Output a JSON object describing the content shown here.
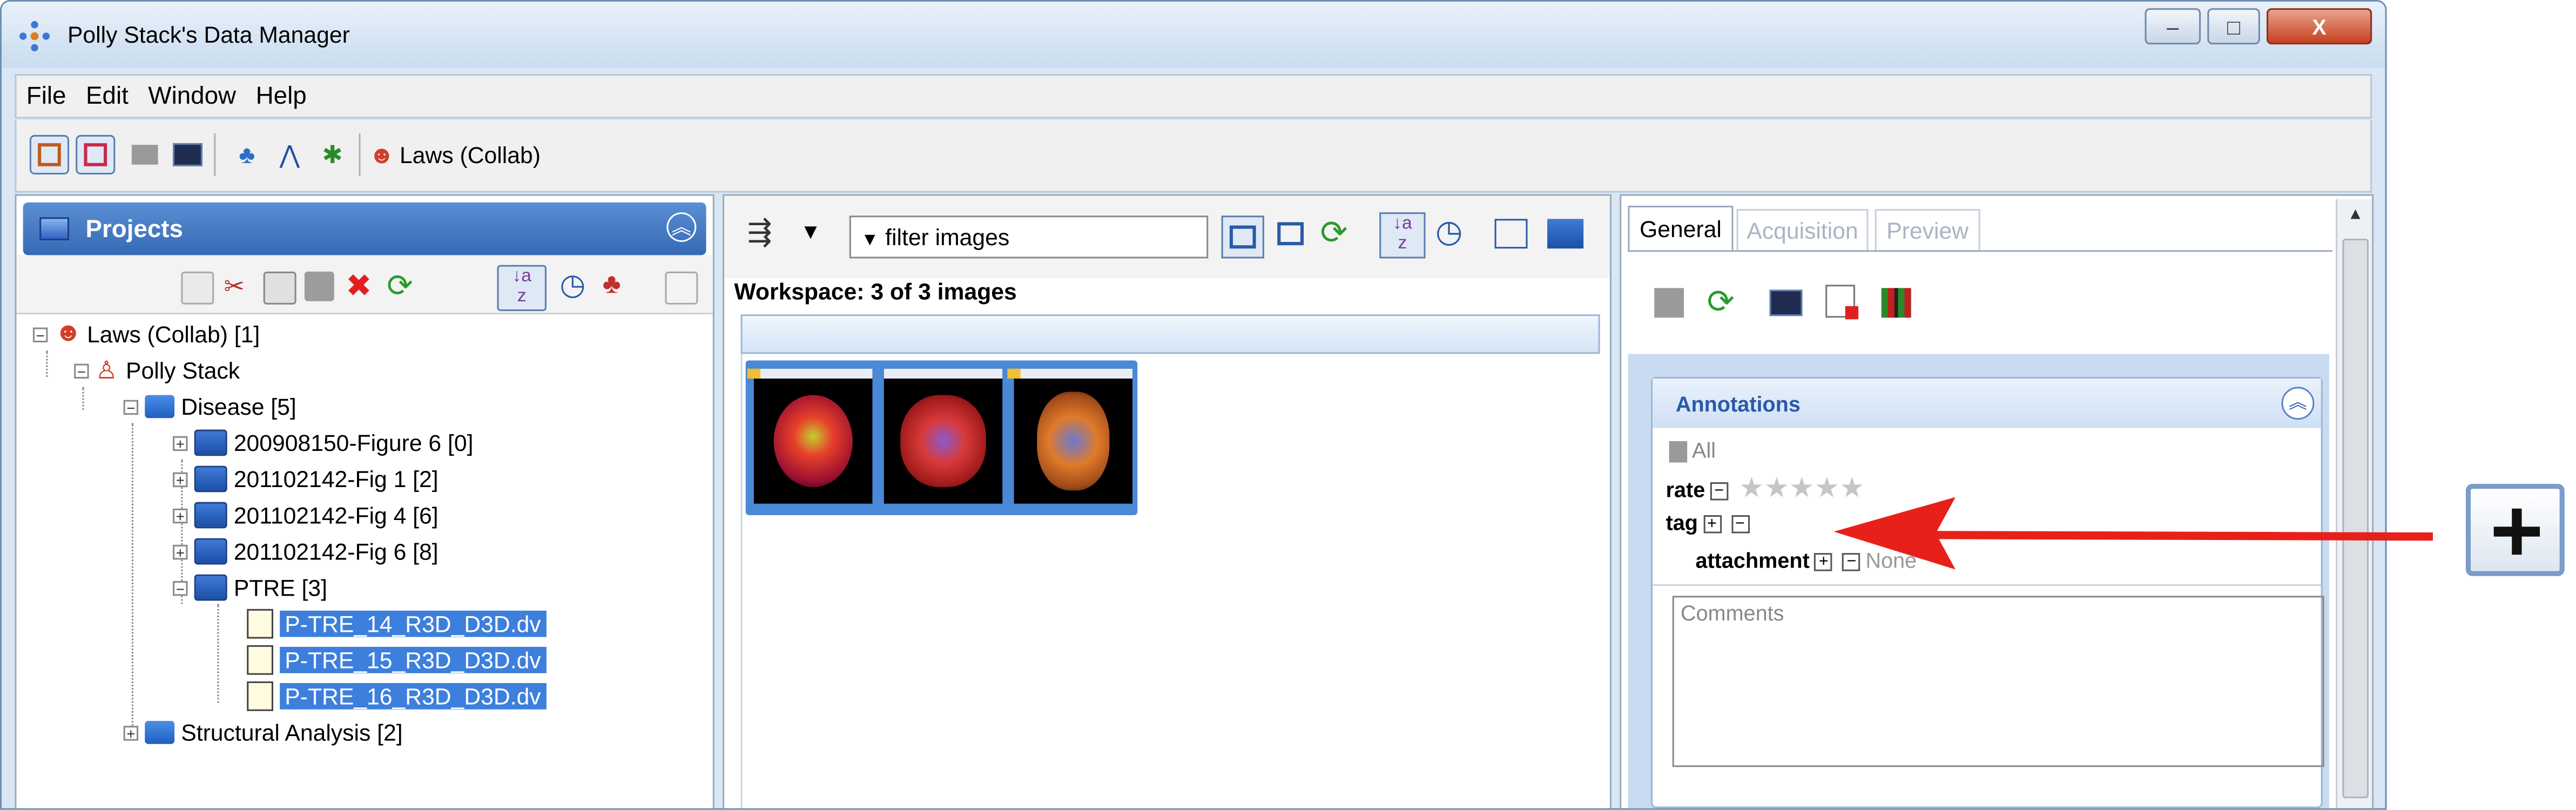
{
  "window": {
    "title": "Polly Stack's Data Manager",
    "controls": {
      "minimize": "–",
      "maximize": "□",
      "close": "X"
    }
  },
  "menu": [
    "File",
    "Edit",
    "Window",
    "Help"
  ],
  "toolbar": {
    "group_label": "Laws (Collab)"
  },
  "projects": {
    "title": "Projects",
    "tree": {
      "root": "Laws (Collab) [1]",
      "user": "Polly Stack",
      "disease": "Disease [5]",
      "datasets": [
        "200908150-Figure 6 [0]",
        "201102142-Fig 1  [2]",
        "201102142-Fig 4 [6]",
        "201102142-Fig 6 [8]",
        "PTRE [3]"
      ],
      "images": [
        "P-TRE_14_R3D_D3D.dv",
        "P-TRE_15_R3D_D3D.dv",
        "P-TRE_16_R3D_D3D.dv"
      ],
      "structural": "Structural Analysis [2]"
    }
  },
  "workspace": {
    "filter_placeholder": "filter  images",
    "filter_label": "filter  images",
    "heading": "Workspace: 3 of 3 images"
  },
  "inspector": {
    "tabs": [
      "General",
      "Acquisition",
      "Preview"
    ],
    "annotations": {
      "title": "Annotations",
      "all_label": "All",
      "rate_label": "rate",
      "rating": 0,
      "tag_label": "tag",
      "attachment_label": "attachment",
      "attachment_value": "None",
      "comments_placeholder": "Comments"
    }
  },
  "callout": {
    "icon": "plus-icon",
    "color": "#e8201a"
  }
}
